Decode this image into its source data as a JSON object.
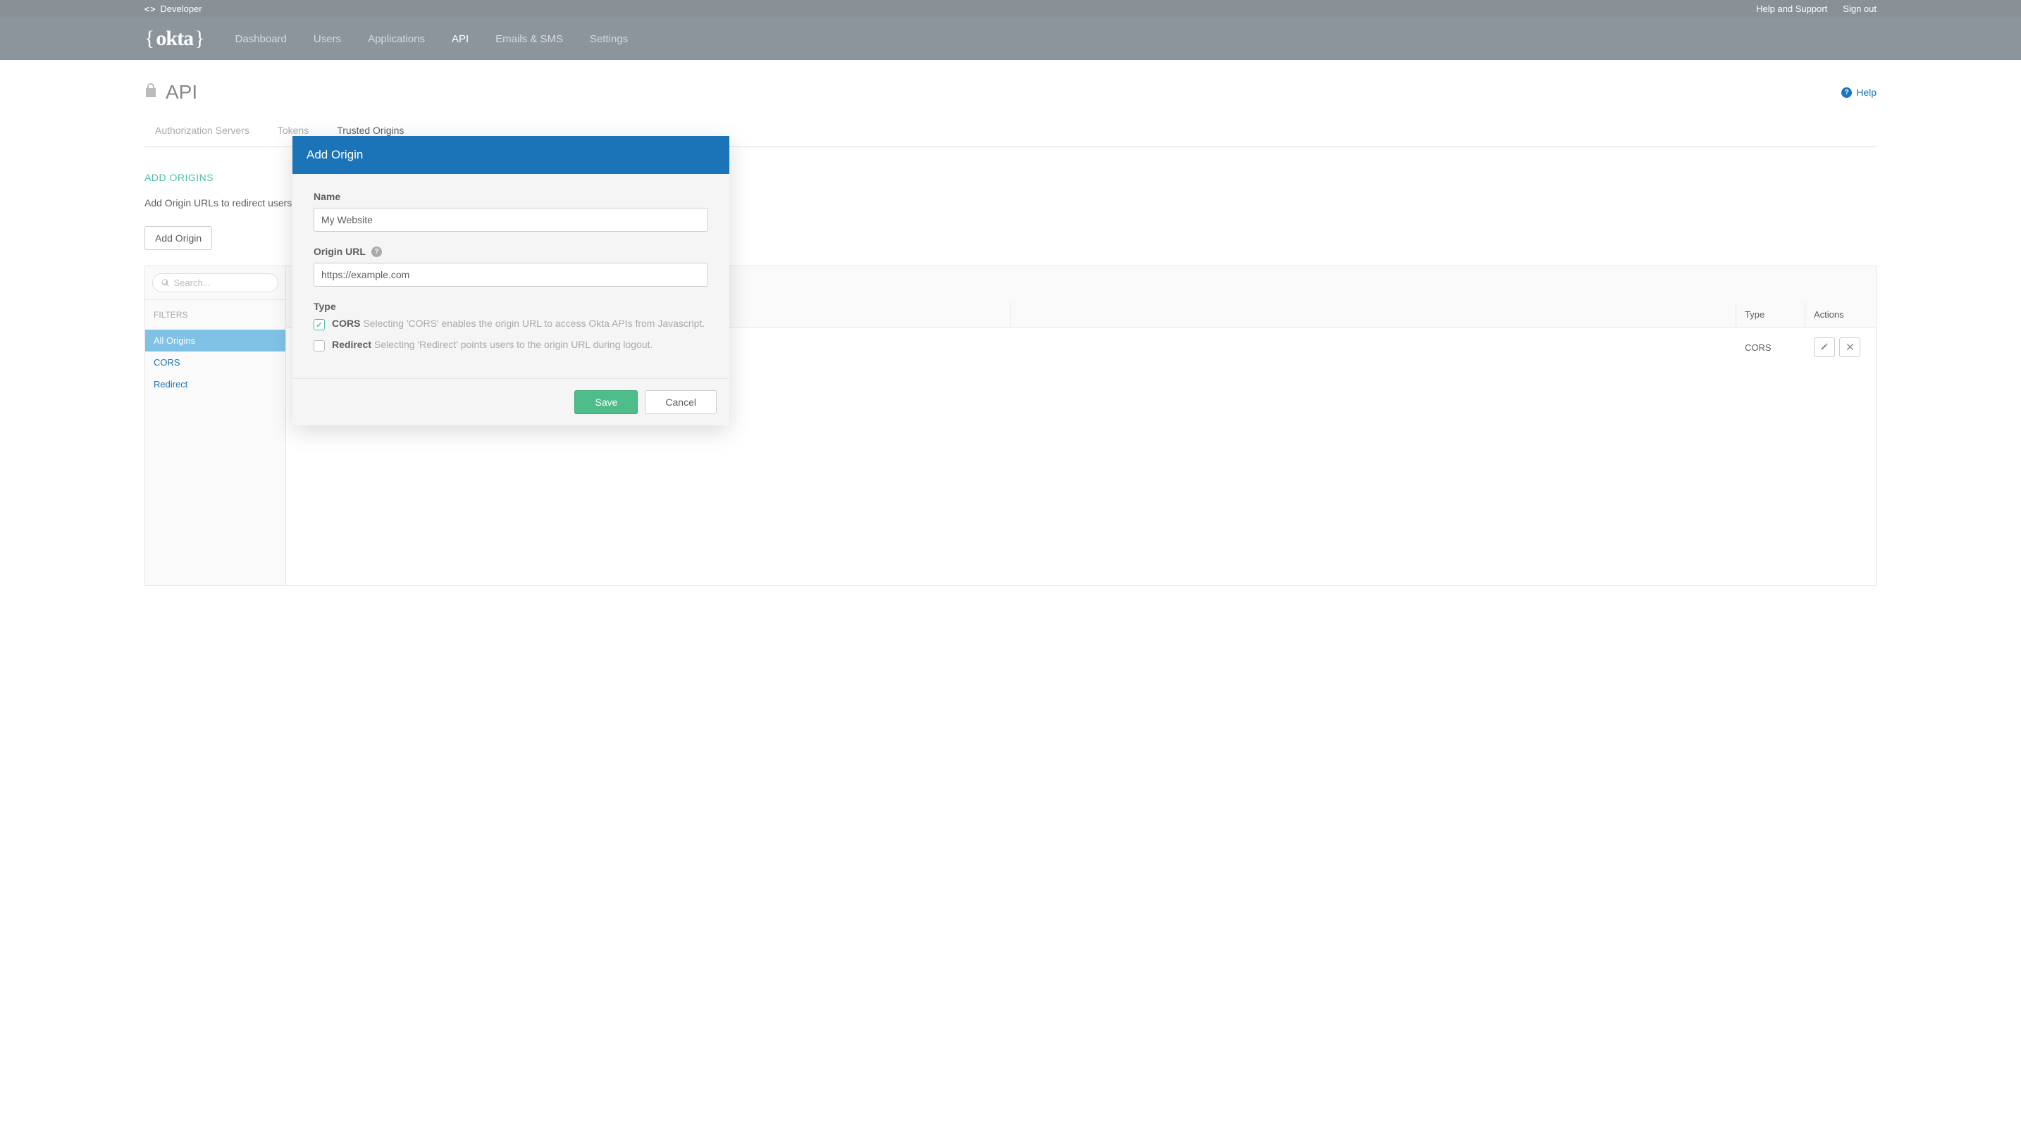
{
  "topbar": {
    "developer_label": "Developer",
    "help_label": "Help and Support",
    "signout_label": "Sign out"
  },
  "nav": {
    "items": [
      {
        "label": "Dashboard",
        "active": false
      },
      {
        "label": "Users",
        "active": false
      },
      {
        "label": "Applications",
        "active": false
      },
      {
        "label": "API",
        "active": true
      },
      {
        "label": "Emails & SMS",
        "active": false
      },
      {
        "label": "Settings",
        "active": false
      }
    ]
  },
  "page": {
    "title": "API",
    "help_label": "Help"
  },
  "tabs": [
    {
      "label": "Authorization Servers",
      "active": false
    },
    {
      "label": "Tokens",
      "active": false
    },
    {
      "label": "Trusted Origins",
      "active": true
    }
  ],
  "section": {
    "title": "ADD ORIGINS",
    "description": "Add Origin URLs to redirect users",
    "add_button": "Add Origin"
  },
  "search": {
    "placeholder": "Search..."
  },
  "filters": {
    "label": "FILTERS",
    "items": [
      {
        "label": "All Origins",
        "active": true
      },
      {
        "label": "CORS",
        "active": false
      },
      {
        "label": "Redirect",
        "active": false
      }
    ]
  },
  "table": {
    "columns": {
      "type": "Type",
      "actions": "Actions"
    },
    "rows": [
      {
        "type": "CORS"
      }
    ]
  },
  "modal": {
    "title": "Add Origin",
    "name_label": "Name",
    "name_value": "My Website",
    "url_label": "Origin URL",
    "url_value": "https://example.com",
    "type_label": "Type",
    "cors_label": "CORS",
    "cors_desc": "Selecting 'CORS' enables the origin URL to access Okta APIs from Javascript.",
    "redirect_label": "Redirect",
    "redirect_desc": "Selecting 'Redirect' points users to the origin URL during logout.",
    "save": "Save",
    "cancel": "Cancel"
  }
}
